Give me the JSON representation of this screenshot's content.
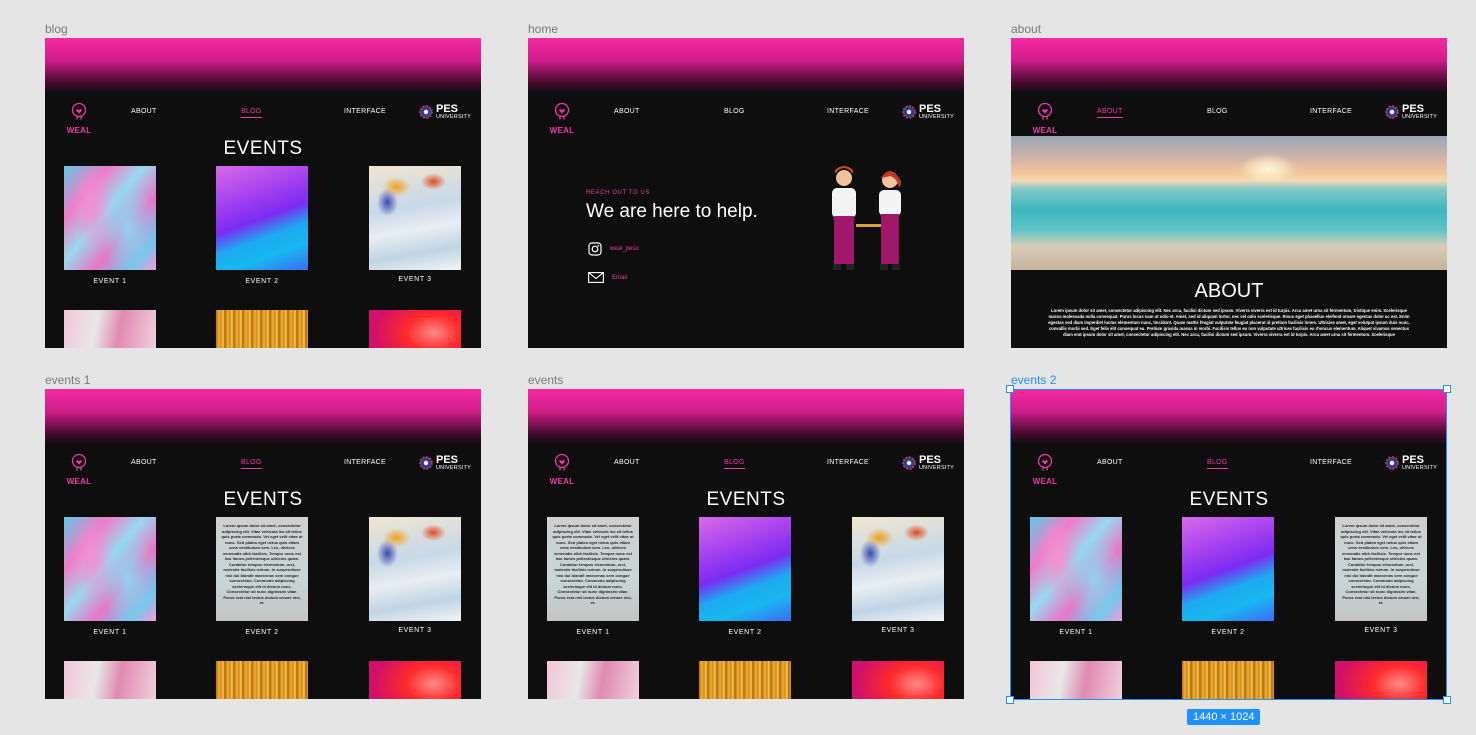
{
  "frames": [
    {
      "id": "blog",
      "label": "blog",
      "type": "events",
      "active_nav": "blog",
      "cards": [
        "marble1",
        "wave2",
        "marble3"
      ]
    },
    {
      "id": "home",
      "label": "home",
      "type": "home",
      "active_nav": "none"
    },
    {
      "id": "about",
      "label": "about",
      "type": "about",
      "active_nav": "about"
    },
    {
      "id": "events1",
      "label": "events 1",
      "type": "events",
      "active_nav": "blog",
      "cards": [
        "marble1",
        "text",
        "marble3"
      ]
    },
    {
      "id": "events",
      "label": "events",
      "type": "events",
      "active_nav": "blog",
      "cards": [
        "text",
        "wave2",
        "marble3"
      ]
    },
    {
      "id": "events2",
      "label": "events 2",
      "type": "events",
      "active_nav": "blog",
      "cards": [
        "marble1",
        "wave2",
        "text"
      ],
      "selected": true
    }
  ],
  "nav": {
    "about": "ABOUT",
    "blog": "BLOG",
    "interface": "INTERFACE"
  },
  "logo": {
    "word": "WEAL"
  },
  "university": {
    "big": "PES",
    "small": "UNIVERSITY"
  },
  "events": {
    "title": "EVENTS",
    "labels": [
      "EVENT 1",
      "EVENT 2",
      "EVENT 3"
    ]
  },
  "card_text": "Lorem ipsum dolor sit amet, consectetur adipiscing elit. Vitae vehicula leo sit tellus quis porta commodo. Vel eget velit vitae ut nunc. Sed platea eget netus quis etiam urna vestibulum sem. Leo, ultrices venenatis nibh facilisis. Tempor nunc est hac fames pellentesque ultricies quam. Curabitur tempus elementum, orci, molestie facilisis rutrum. In suspendisse nisi dui blandit maecenas sem congue consectetur. Commodo adipiscing scelerisque elit id dictum nunc. Consectetur sit nunc dignissim vitae. Purus erat nisl lectus dictum ornare nisi, et.",
  "home": {
    "sub": "REACH OUT TO US",
    "headline": "We are here to help.",
    "instagram": "weal_pesu",
    "email": "Email"
  },
  "about": {
    "title": "ABOUT",
    "text": "Lorem ipsum dolor sit amet, consectetur adipiscing elit. Nec arcu, facilisi dictum sed ipsum. Viverra viverra est id turpis. Arcu amet urna sit fermentum, tristique enim. Scelerisque massa malesuada nulla consequat. Purus locus nam ut odio et. Amet, sed id aliquam tortor, nec vel odio scelerisque. Risus eget phasellus eleifend ornare egestas dolor ac est. Enim egestas sed diam imperdiet luctus elementum nunc, tincidunt. Quam mattis feugiat vulputate feugiat placerat id pretium facilisis lorem. Ultricies amet, eget volutpat ipsum duis nunc, convallis morbi sed. Eget felis elit consequat eu. Pretium gravida massa in morbi. Facilisis tellus eu non vulputate ultrices facilisis eu rhoncus elementum. Aliquet vivamus senectus diam erat ipsum dolor sit amet, consectetur adipiscing elit. Nec arcu, facilisi dictum sed ipsum. Viverra viverra est id turpis. Arcu amet urna sit fermentum. Scelerisque"
  },
  "selection": {
    "size_badge": "1440 × 1024"
  },
  "colors": {
    "accent": "#ee3aa8",
    "bg": "#0e0e0e",
    "canvas": "#e5e5e5",
    "selection": "#1e90ff"
  }
}
